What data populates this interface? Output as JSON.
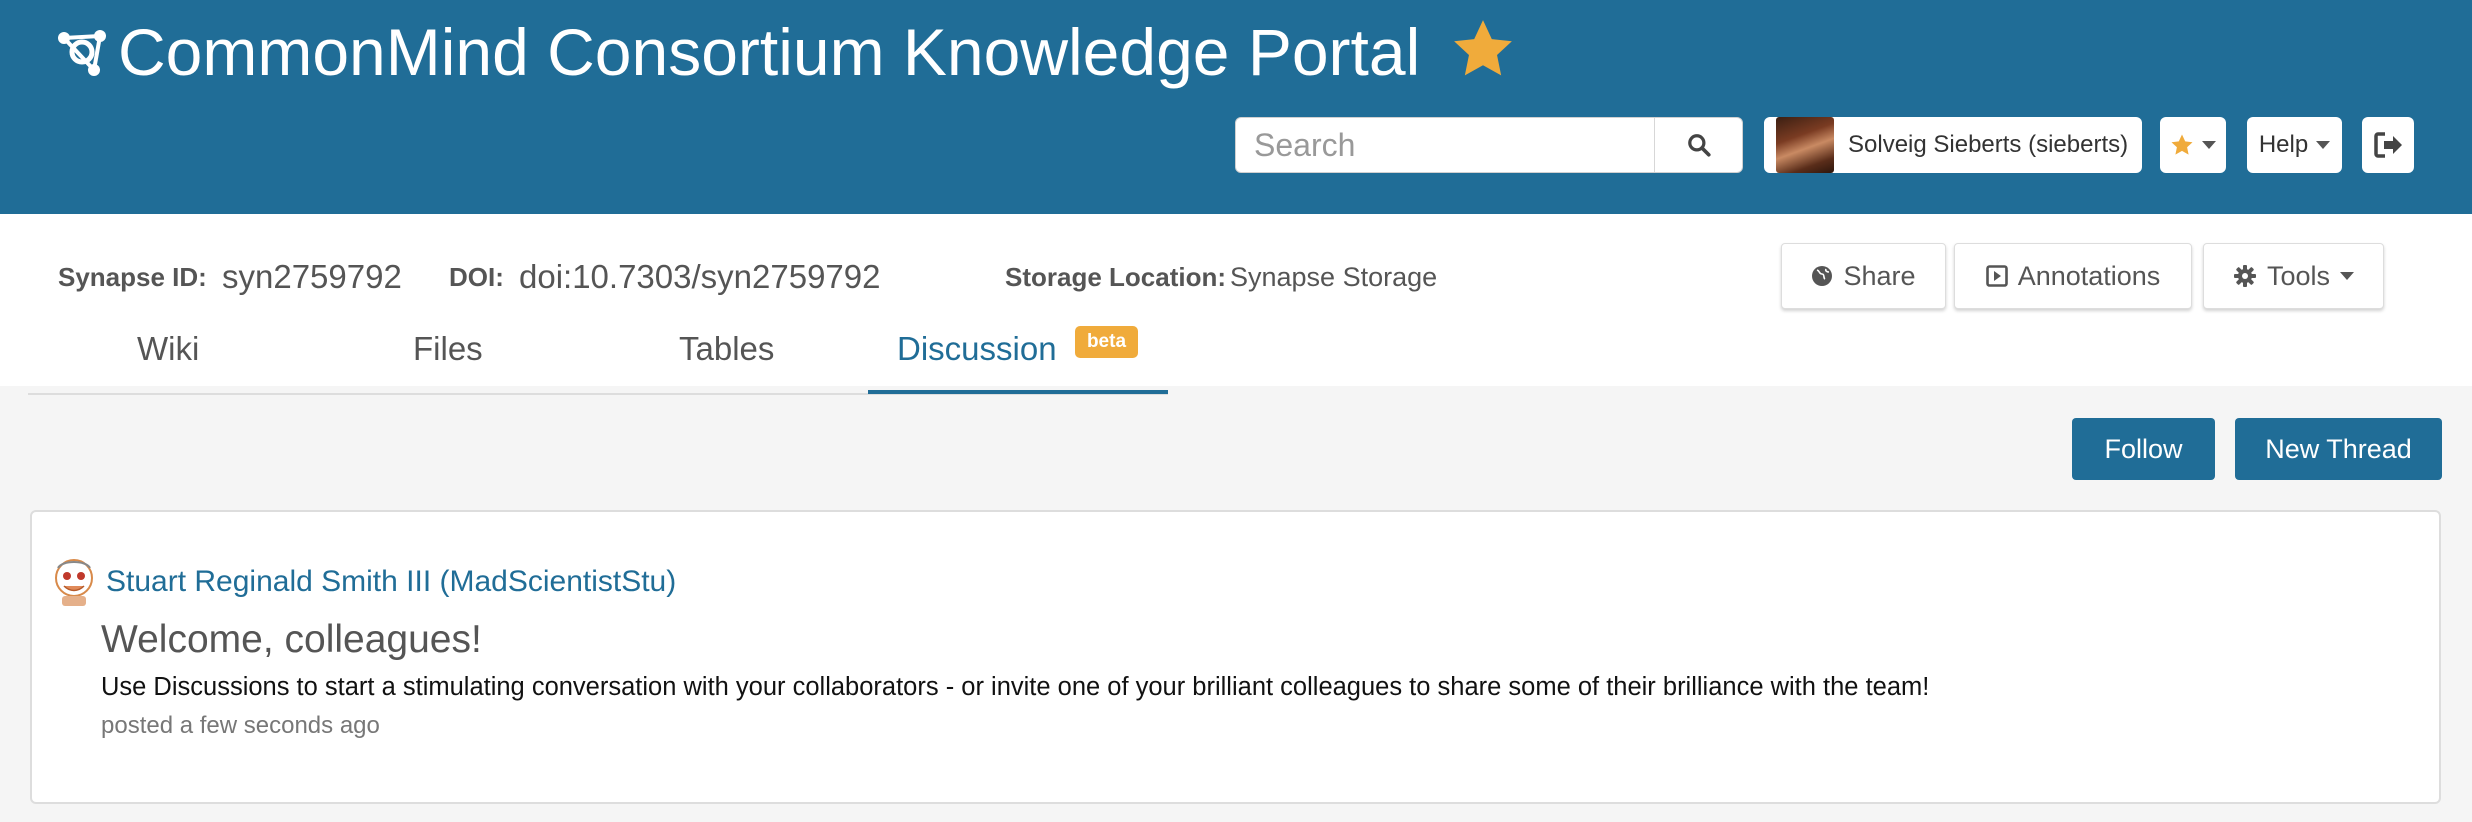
{
  "header": {
    "portal_title": "CommonMind Consortium Knowledge Portal",
    "search_placeholder": "Search",
    "user_name": "Solveig Sieberts (sieberts)",
    "help_label": "Help",
    "colors": {
      "header_bg": "#206d97",
      "star": "#f0ab3b"
    },
    "icons": [
      "logo-icon",
      "star-icon",
      "search-icon",
      "favorites-star-icon",
      "logout-icon"
    ]
  },
  "entity": {
    "synapse_id_label": "Synapse ID:",
    "synapse_id": "syn2759792",
    "doi_label": "DOI:",
    "doi": "doi:10.7303/syn2759792",
    "storage_label": "Storage Location:",
    "storage_value": "Synapse Storage",
    "share_label": "Share",
    "annotations_label": "Annotations",
    "tools_label": "Tools"
  },
  "tabs": [
    {
      "label": "Wiki",
      "active": false
    },
    {
      "label": "Files",
      "active": false
    },
    {
      "label": "Tables",
      "active": false
    },
    {
      "label": "Discussion",
      "active": true,
      "badge": "beta"
    }
  ],
  "discussion": {
    "follow_label": "Follow",
    "new_thread_label": "New Thread",
    "thread": {
      "author": "Stuart Reginald Smith III (MadScientistStu)",
      "title": "Welcome, colleagues!",
      "body": "Use Discussions to start a stimulating conversation with your collaborators - or invite one of your brilliant colleagues to share some of their brilliance with the team!",
      "meta": "posted a few seconds ago"
    }
  }
}
